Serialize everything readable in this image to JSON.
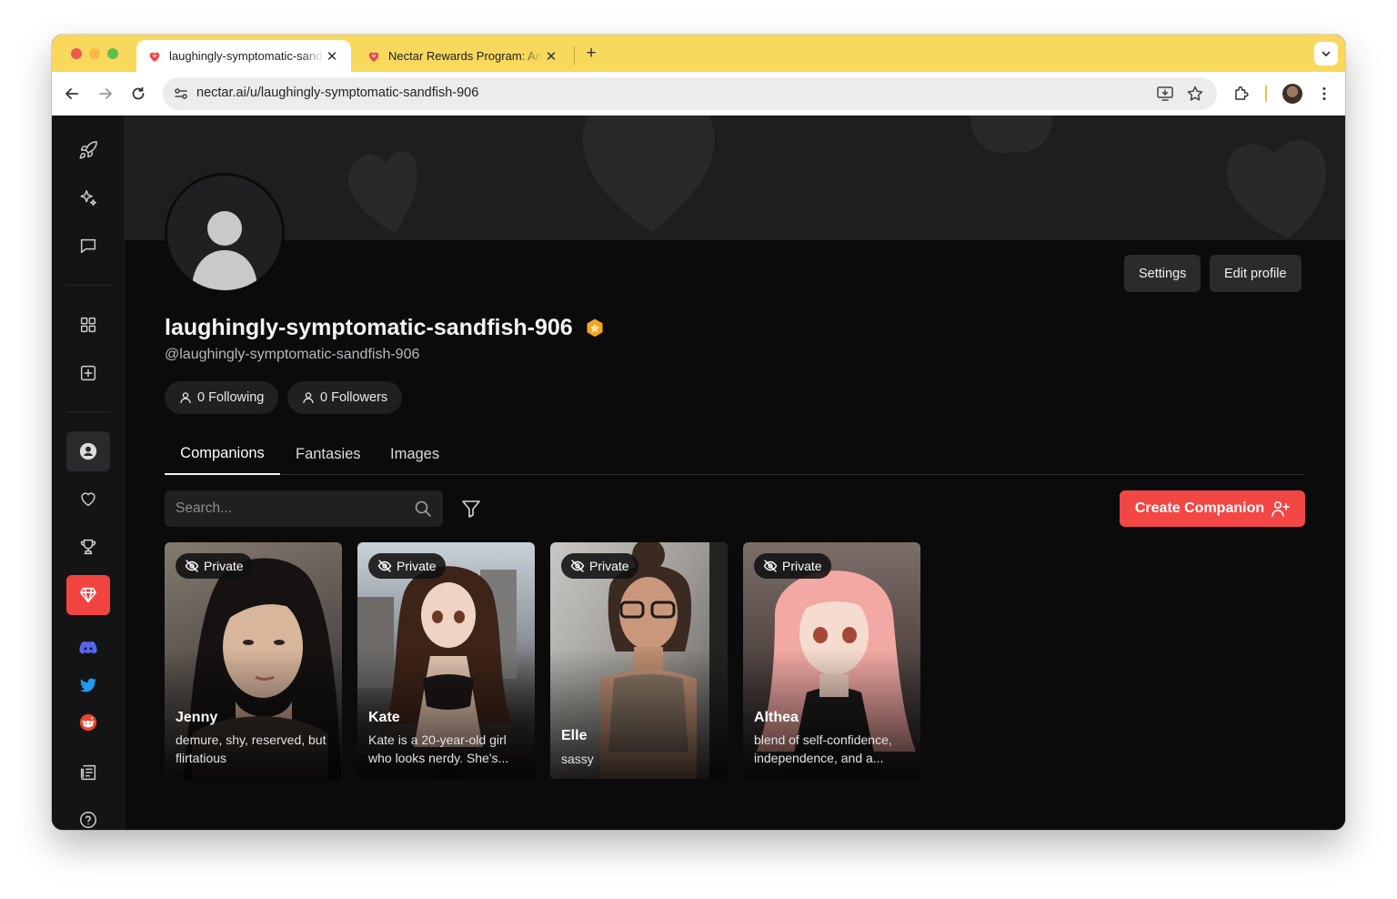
{
  "browser": {
    "tabs": [
      {
        "title": "laughingly-symptomatic-sandfish-906",
        "active": true
      },
      {
        "title": "Nectar Rewards Program: An",
        "active": false
      }
    ],
    "url": "nectar.ai/u/laughingly-symptomatic-sandfish-906",
    "new_tab_label": "+",
    "close_label": "✕"
  },
  "colors": {
    "tab_bar": "#f9d85e",
    "accent": "#f24744",
    "background": "#0b0b0c",
    "verified_badge": "#f5a623"
  },
  "sidebar": {
    "items": [
      {
        "icon": "rocket-icon"
      },
      {
        "icon": "sparkles-icon"
      },
      {
        "icon": "chat-icon"
      },
      {
        "icon": "grid-icon"
      },
      {
        "icon": "plus-square-icon"
      },
      {
        "icon": "user-icon",
        "active": true
      },
      {
        "icon": "heart-icon"
      },
      {
        "icon": "trophy-icon"
      },
      {
        "icon": "gem-icon",
        "highlight": true
      },
      {
        "icon": "discord-icon"
      },
      {
        "icon": "twitter-icon"
      },
      {
        "icon": "reddit-icon"
      },
      {
        "icon": "newspaper-icon"
      },
      {
        "icon": "help-icon"
      }
    ]
  },
  "profile": {
    "display_name": "laughingly-symptomatic-sandfish-906",
    "handle": "@laughingly-symptomatic-sandfish-906",
    "following_label": "0 Following",
    "followers_label": "0 Followers",
    "settings_label": "Settings",
    "edit_label": "Edit profile"
  },
  "content_tabs": [
    {
      "label": "Companions",
      "active": true
    },
    {
      "label": "Fantasies",
      "active": false
    },
    {
      "label": "Images",
      "active": false
    }
  ],
  "search": {
    "placeholder": "Search...",
    "value": ""
  },
  "create_button_label": "Create Companion",
  "companions": [
    {
      "name": "Jenny",
      "description": "demure, shy, reserved, but flirtatious",
      "badge": "Private"
    },
    {
      "name": "Kate",
      "description": "Kate is a 20-year-old girl who looks nerdy. She's...",
      "badge": "Private"
    },
    {
      "name": "Elle",
      "description": "sassy",
      "badge": "Private"
    },
    {
      "name": "Althea",
      "description": "blend of self-confidence, independence, and a...",
      "badge": "Private"
    }
  ]
}
